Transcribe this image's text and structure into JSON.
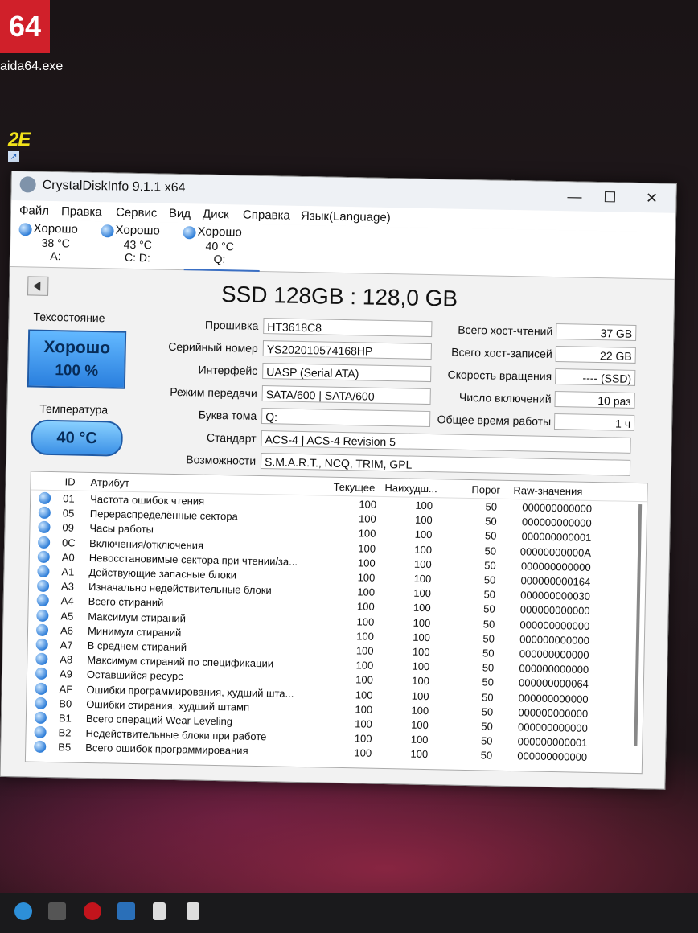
{
  "desktop": {
    "aida_icon_text": "64",
    "aida_label": "aida64.exe",
    "brand_icon_text": "2E"
  },
  "window": {
    "title": "CrystalDiskInfo 9.1.1 x64",
    "controls": {
      "minimize": "—",
      "maximize": "☐",
      "close": "✕"
    }
  },
  "menu": [
    "Файл",
    "Правка",
    "Сервис",
    "Вид",
    "Диск",
    "Справка",
    "Язык(Language)"
  ],
  "disks": [
    {
      "status": "Хорошо",
      "temp": "38 °C",
      "letter": "A:"
    },
    {
      "status": "Хорошо",
      "temp": "43 °C",
      "letter": "C: D:"
    },
    {
      "status": "Хорошо",
      "temp": "40 °C",
      "letter": "Q:"
    }
  ],
  "disk": {
    "title": "SSD 128GB : 128,0 GB",
    "health_label": "Техсостояние",
    "health_status": "Хорошо",
    "health_percent": "100 %",
    "temp_label": "Температура",
    "temp_value": "40 °C",
    "fields": [
      {
        "label": "Прошивка",
        "value": "HT3618C8"
      },
      {
        "label": "Серийный номер",
        "value": "YS202010574168HP"
      },
      {
        "label": "Интерфейс",
        "value": "UASP (Serial ATA)"
      },
      {
        "label": "Режим передачи",
        "value": "SATA/600 | SATA/600"
      },
      {
        "label": "Буква тома",
        "value": "Q:"
      },
      {
        "label": "Стандарт",
        "value": "ACS-4 | ACS-4 Revision 5"
      },
      {
        "label": "Возможности",
        "value": "S.M.A.R.T., NCQ, TRIM, GPL"
      }
    ],
    "right_fields": [
      {
        "label": "Всего хост-чтений",
        "value": "37 GB"
      },
      {
        "label": "Всего хост-записей",
        "value": "22 GB"
      },
      {
        "label": "Скорость вращения",
        "value": "---- (SSD)"
      },
      {
        "label": "Число включений",
        "value": "10 раз"
      },
      {
        "label": "Общее время работы",
        "value": "1 ч"
      }
    ]
  },
  "smart": {
    "headers": {
      "id": "ID",
      "attr": "Атрибут",
      "cur": "Текущее",
      "worst": "Наихудш...",
      "thr": "Порог",
      "raw": "Raw-значения"
    },
    "rows": [
      {
        "id": "01",
        "name": "Частота ошибок чтения",
        "cur": "100",
        "worst": "100",
        "thr": "50",
        "raw": "000000000000"
      },
      {
        "id": "05",
        "name": "Перераспределённые сектора",
        "cur": "100",
        "worst": "100",
        "thr": "50",
        "raw": "000000000000"
      },
      {
        "id": "09",
        "name": "Часы работы",
        "cur": "100",
        "worst": "100",
        "thr": "50",
        "raw": "000000000001"
      },
      {
        "id": "0C",
        "name": "Включения/отключения",
        "cur": "100",
        "worst": "100",
        "thr": "50",
        "raw": "00000000000A"
      },
      {
        "id": "A0",
        "name": "Невосстановимые сектора при чтении/за...",
        "cur": "100",
        "worst": "100",
        "thr": "50",
        "raw": "000000000000"
      },
      {
        "id": "A1",
        "name": "Действующие запасные блоки",
        "cur": "100",
        "worst": "100",
        "thr": "50",
        "raw": "000000000164"
      },
      {
        "id": "A3",
        "name": "Изначально недействительные блоки",
        "cur": "100",
        "worst": "100",
        "thr": "50",
        "raw": "000000000030"
      },
      {
        "id": "A4",
        "name": "Всего стираний",
        "cur": "100",
        "worst": "100",
        "thr": "50",
        "raw": "000000000000"
      },
      {
        "id": "A5",
        "name": "Максимум стираний",
        "cur": "100",
        "worst": "100",
        "thr": "50",
        "raw": "000000000000"
      },
      {
        "id": "A6",
        "name": "Минимум стираний",
        "cur": "100",
        "worst": "100",
        "thr": "50",
        "raw": "000000000000"
      },
      {
        "id": "A7",
        "name": "В среднем стираний",
        "cur": "100",
        "worst": "100",
        "thr": "50",
        "raw": "000000000000"
      },
      {
        "id": "A8",
        "name": "Максимум стираний по спецификации",
        "cur": "100",
        "worst": "100",
        "thr": "50",
        "raw": "000000000000"
      },
      {
        "id": "A9",
        "name": "Оставшийся ресурс",
        "cur": "100",
        "worst": "100",
        "thr": "50",
        "raw": "000000000064"
      },
      {
        "id": "AF",
        "name": "Ошибки программирования, худший шта...",
        "cur": "100",
        "worst": "100",
        "thr": "50",
        "raw": "000000000000"
      },
      {
        "id": "B0",
        "name": "Ошибки стирания, худший штамп",
        "cur": "100",
        "worst": "100",
        "thr": "50",
        "raw": "000000000000"
      },
      {
        "id": "B1",
        "name": "Всего операций Wear Leveling",
        "cur": "100",
        "worst": "100",
        "thr": "50",
        "raw": "000000000000"
      },
      {
        "id": "B2",
        "name": "Недействительные блоки при работе",
        "cur": "100",
        "worst": "100",
        "thr": "50",
        "raw": "000000000001"
      },
      {
        "id": "B5",
        "name": "Всего ошибок программирования",
        "cur": "100",
        "worst": "100",
        "thr": "50",
        "raw": "000000000000"
      }
    ]
  }
}
